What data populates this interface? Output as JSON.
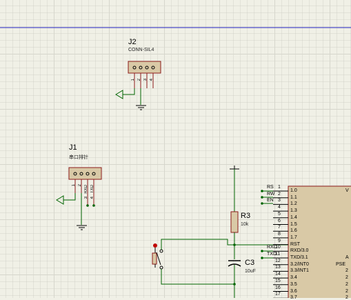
{
  "colors": {
    "background": "#f0f0e6",
    "grid": "#d6d6cc",
    "sheet_border": "#2020c0",
    "component_outline": "#8b1a1a",
    "component_fill": "#d9c9a6",
    "wire": "#006400",
    "junction": "#006400",
    "pin": "#000000"
  },
  "components": {
    "j2": {
      "refdes": "J2",
      "value": "CONN-SIL4",
      "pins": [
        "1",
        "2",
        "3",
        "4"
      ]
    },
    "j1": {
      "refdes": "J1",
      "value": "串口排针",
      "pins": [
        "1",
        "2",
        "3",
        "4"
      ],
      "pin_labels": [
        "RXD",
        "TXD"
      ],
      "pin_numbers_shown": [
        "3",
        "4"
      ]
    },
    "r3": {
      "refdes": "R3",
      "value": "10k"
    },
    "c3": {
      "refdes": "C3",
      "value": "10uF"
    },
    "mcu": {
      "left_pins": [
        {
          "num": "1",
          "name": "1.0",
          "net": "RS"
        },
        {
          "num": "2",
          "name": "1.1",
          "net": "RW"
        },
        {
          "num": "3",
          "name": "1.2",
          "net": "EN"
        },
        {
          "num": "4",
          "name": "1.3",
          "net": ""
        },
        {
          "num": "5",
          "name": "1.4",
          "net": ""
        },
        {
          "num": "6",
          "name": "1.5",
          "net": ""
        },
        {
          "num": "7",
          "name": "1.6",
          "net": ""
        },
        {
          "num": "8",
          "name": "1.7",
          "net": ""
        },
        {
          "num": "9",
          "name": "RST",
          "net": ""
        },
        {
          "num": "10",
          "name": "RXD/3.0",
          "net": "RXD"
        },
        {
          "num": "11",
          "name": "TXD/3.1",
          "net": "TXD"
        },
        {
          "num": "12",
          "name": "3.2/INT0",
          "net": ""
        },
        {
          "num": "13",
          "name": "3.3/INT1",
          "net": ""
        },
        {
          "num": "14",
          "name": "3.4",
          "net": ""
        },
        {
          "num": "15",
          "name": "3.5",
          "net": ""
        },
        {
          "num": "16",
          "name": "3.6",
          "net": ""
        },
        {
          "num": "17",
          "name": "3.7",
          "net": ""
        }
      ],
      "right_edge_fragments": [
        "V",
        "",
        "",
        "",
        "",
        "",
        "",
        "",
        "",
        "",
        "A",
        "PSE",
        "2",
        "2",
        "2",
        "2",
        "2"
      ]
    }
  }
}
